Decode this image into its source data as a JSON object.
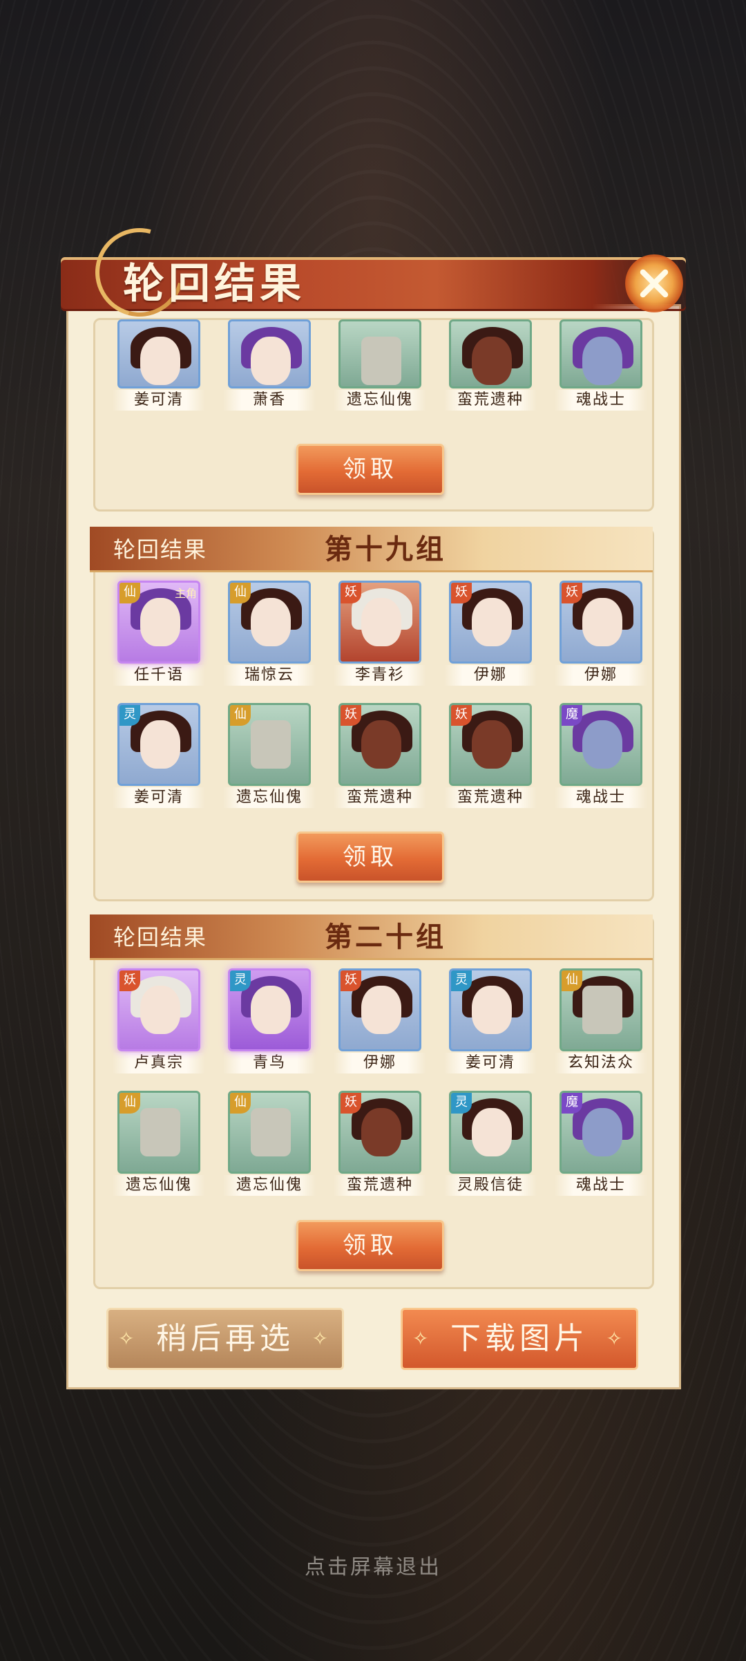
{
  "window": {
    "title": "轮回结果",
    "close_icon": "close-x-icon"
  },
  "top_partial_group": {
    "heroes": [
      {
        "name": "姜可清",
        "badge": "",
        "frame": "blue",
        "hair": "dark",
        "face": "pale"
      },
      {
        "name": "萧香",
        "badge": "",
        "frame": "blue",
        "hair": "purple",
        "face": "pale"
      },
      {
        "name": "遗忘仙傀",
        "badge": "",
        "frame": "green",
        "hair": "none",
        "face": "grey"
      },
      {
        "name": "蛮荒遗种",
        "badge": "",
        "frame": "green",
        "hair": "dark",
        "face": "dark"
      },
      {
        "name": "魂战士",
        "badge": "",
        "frame": "green",
        "hair": "purple",
        "face": "blue"
      }
    ],
    "claim_label": "领取"
  },
  "groups": [
    {
      "label": "轮回结果",
      "name": "第十九组",
      "claim_label": "领取",
      "heroes": [
        {
          "name": "任千语",
          "badge": "仙",
          "badge_type": "xian",
          "frame": "purple",
          "main_tag": "主角",
          "hair": "purple",
          "face": "pale"
        },
        {
          "name": "瑞惊云",
          "badge": "仙",
          "badge_type": "xian",
          "frame": "blue",
          "main_tag": "",
          "hair": "dark",
          "face": "pale"
        },
        {
          "name": "李青衫",
          "badge": "妖",
          "badge_type": "yao",
          "frame": "red",
          "main_tag": "",
          "hair": "white",
          "face": "pale"
        },
        {
          "name": "伊娜",
          "badge": "妖",
          "badge_type": "yao",
          "frame": "blue",
          "main_tag": "",
          "hair": "dark",
          "face": "pale"
        },
        {
          "name": "伊娜",
          "badge": "妖",
          "badge_type": "yao",
          "frame": "blue",
          "main_tag": "",
          "hair": "dark",
          "face": "pale"
        },
        {
          "name": "姜可清",
          "badge": "灵",
          "badge_type": "ling",
          "frame": "blue",
          "main_tag": "",
          "hair": "dark",
          "face": "pale"
        },
        {
          "name": "遗忘仙傀",
          "badge": "仙",
          "badge_type": "xian",
          "frame": "green",
          "main_tag": "",
          "hair": "none",
          "face": "grey"
        },
        {
          "name": "蛮荒遗种",
          "badge": "妖",
          "badge_type": "yao",
          "frame": "green",
          "main_tag": "",
          "hair": "dark",
          "face": "dark"
        },
        {
          "name": "蛮荒遗种",
          "badge": "妖",
          "badge_type": "yao",
          "frame": "green",
          "main_tag": "",
          "hair": "dark",
          "face": "dark"
        },
        {
          "name": "魂战士",
          "badge": "魔",
          "badge_type": "mo",
          "frame": "green",
          "main_tag": "",
          "hair": "purple",
          "face": "blue"
        }
      ]
    },
    {
      "label": "轮回结果",
      "name": "第二十组",
      "claim_label": "领取",
      "heroes": [
        {
          "name": "卢真宗",
          "badge": "妖",
          "badge_type": "yao",
          "frame": "purple",
          "main_tag": "",
          "hair": "white",
          "face": "pale"
        },
        {
          "name": "青鸟",
          "badge": "灵",
          "badge_type": "ling",
          "frame": "purple2",
          "main_tag": "",
          "hair": "purple",
          "face": "pale"
        },
        {
          "name": "伊娜",
          "badge": "妖",
          "badge_type": "yao",
          "frame": "blue",
          "main_tag": "",
          "hair": "dark",
          "face": "pale"
        },
        {
          "name": "姜可清",
          "badge": "灵",
          "badge_type": "ling",
          "frame": "blue",
          "main_tag": "",
          "hair": "dark",
          "face": "pale"
        },
        {
          "name": "玄知法众",
          "badge": "仙",
          "badge_type": "xian",
          "frame": "green",
          "main_tag": "",
          "hair": "dark",
          "face": "grey"
        },
        {
          "name": "遗忘仙傀",
          "badge": "仙",
          "badge_type": "xian",
          "frame": "green",
          "main_tag": "",
          "hair": "none",
          "face": "grey"
        },
        {
          "name": "遗忘仙傀",
          "badge": "仙",
          "badge_type": "xian",
          "frame": "green",
          "main_tag": "",
          "hair": "none",
          "face": "grey"
        },
        {
          "name": "蛮荒遗种",
          "badge": "妖",
          "badge_type": "yao",
          "frame": "green",
          "main_tag": "",
          "hair": "dark",
          "face": "dark"
        },
        {
          "name": "灵殿信徒",
          "badge": "灵",
          "badge_type": "ling",
          "frame": "green",
          "main_tag": "",
          "hair": "dark",
          "face": "pale"
        },
        {
          "name": "魂战士",
          "badge": "魔",
          "badge_type": "mo",
          "frame": "green",
          "main_tag": "",
          "hair": "purple",
          "face": "blue"
        }
      ]
    }
  ],
  "actions": {
    "later_label": "稍后再选",
    "download_label": "下载图片"
  },
  "exit_hint": "点击屏幕退出"
}
